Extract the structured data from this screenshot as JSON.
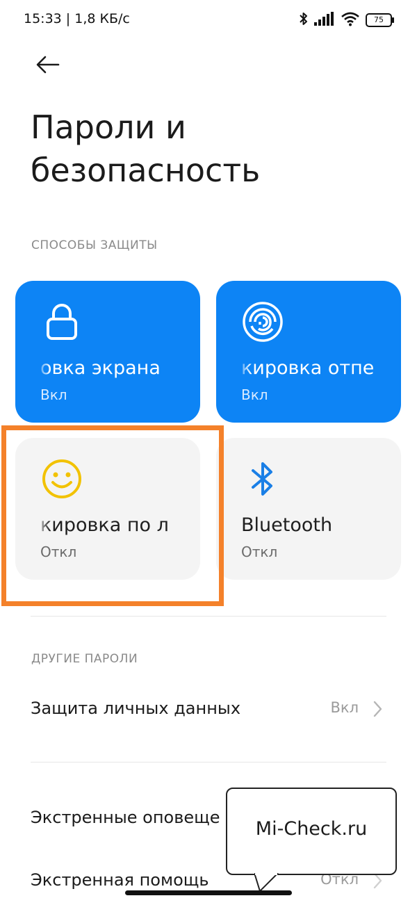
{
  "status_bar": {
    "time_speed": "15:33 | 1,8 КБ/с",
    "battery": "75",
    "icons": [
      "bluetooth-icon",
      "signal-icon",
      "wifi-icon",
      "battery-icon"
    ]
  },
  "header": {
    "back_icon": "arrow-left-icon",
    "title": "Пароли и безопасность"
  },
  "protection": {
    "section_title": "СПОСОБЫ ЗАЩИТЫ",
    "cards": [
      {
        "label": "овка экрана",
        "status": "Вкл",
        "icon": "lock-icon",
        "style": "blue"
      },
      {
        "label": "кировка отпе",
        "status": "Вкл",
        "icon": "fingerprint-icon",
        "style": "blue"
      },
      {
        "label": "кировка по л",
        "status": "Откл",
        "icon": "smiley-face-icon",
        "style": "gray"
      },
      {
        "label": "Bluetooth",
        "status": "Откл",
        "icon": "bluetooth-icon",
        "style": "gray"
      }
    ]
  },
  "other": {
    "section_title": "ДРУГИЕ ПАРОЛИ",
    "rows": [
      {
        "label": "Защита личных данных",
        "value": "Вкл"
      },
      {
        "label": "Экстренные оповеще",
        "value": ""
      },
      {
        "label": "Экстренная помощь",
        "value": "Откл"
      }
    ]
  },
  "watermark": {
    "text": "Mi-Check.ru"
  },
  "colors": {
    "card_blue": "#0d84f5",
    "card_gray": "#f4f4f4",
    "highlight_orange": "#f4812a",
    "smiley_yellow": "#f2c200",
    "bluetooth_blue": "#1a7fe6"
  }
}
